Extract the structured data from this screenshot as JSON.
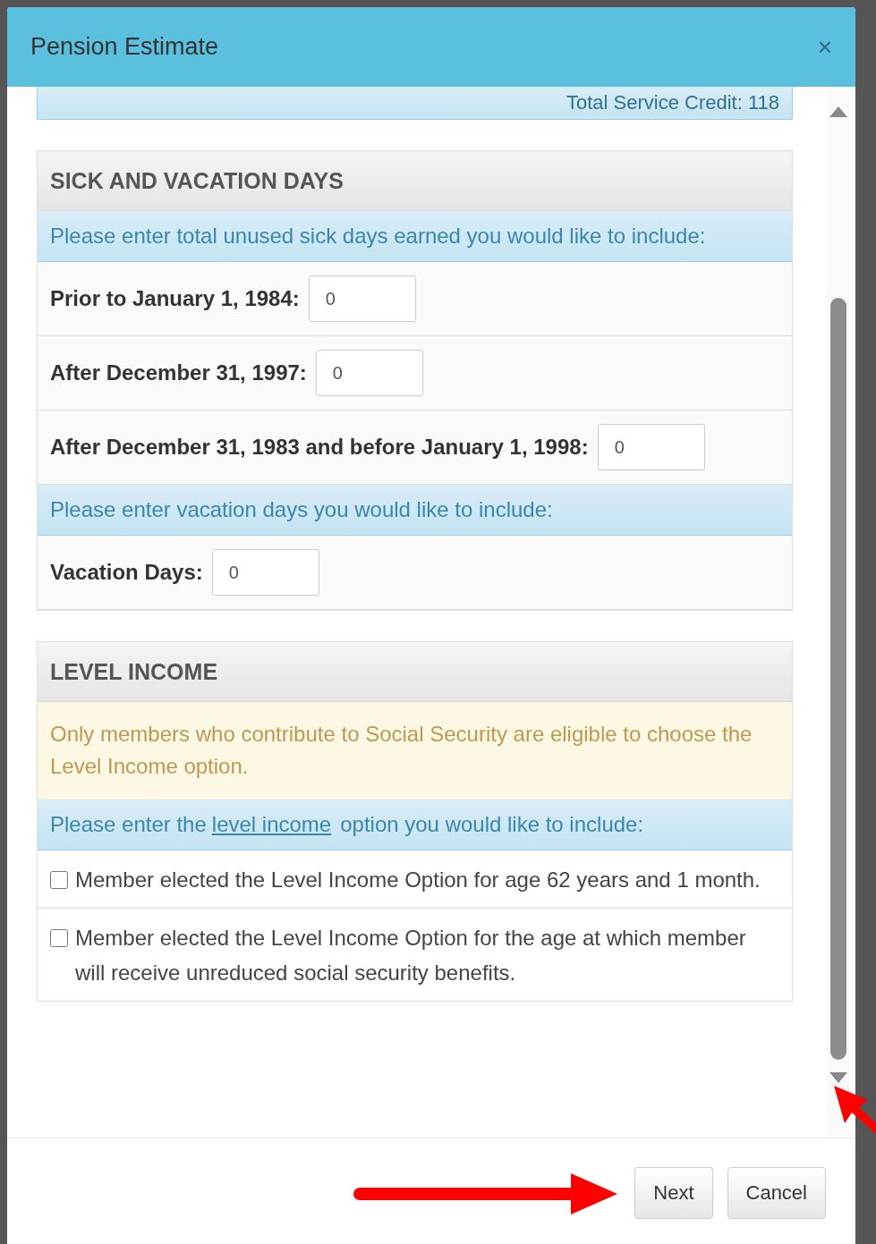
{
  "modal": {
    "title": "Pension Estimate",
    "close_label": "×"
  },
  "summary": {
    "text": "Total Service Credit: 118"
  },
  "sections": [
    {
      "title": "SICK AND VACATION DAYS",
      "rows": [
        {
          "kind": "info",
          "text": "Please enter total unused sick days earned you would like to include:"
        },
        {
          "kind": "field",
          "label": "Prior to January 1, 1984:",
          "value": "0"
        },
        {
          "kind": "field",
          "label": "After December 31, 1997:",
          "value": "0"
        },
        {
          "kind": "field",
          "label": "After December 31, 1983 and before January 1, 1998:",
          "value": "0"
        },
        {
          "kind": "info",
          "text": "Please enter vacation days you would like to include:"
        },
        {
          "kind": "field",
          "label": "Vacation Days:",
          "value": "0"
        }
      ]
    },
    {
      "title": "LEVEL INCOME",
      "rows": [
        {
          "kind": "warning",
          "text": "Only members who contribute to Social Security are eligible to choose the Level Income option."
        },
        {
          "kind": "info",
          "text": "Please enter the",
          "link": "level income",
          "after": "option you would like to include:"
        },
        {
          "kind": "checkbox",
          "label": "Member elected the Level Income Option for age 62 years and 1 month.",
          "checked": false
        },
        {
          "kind": "checkbox",
          "label": "Member elected the Level Income Option for the age at which member will receive unreduced social security benefits.",
          "checked": false
        }
      ]
    }
  ],
  "buttons": [
    {
      "label": "Next"
    },
    {
      "label": "Cancel"
    }
  ]
}
